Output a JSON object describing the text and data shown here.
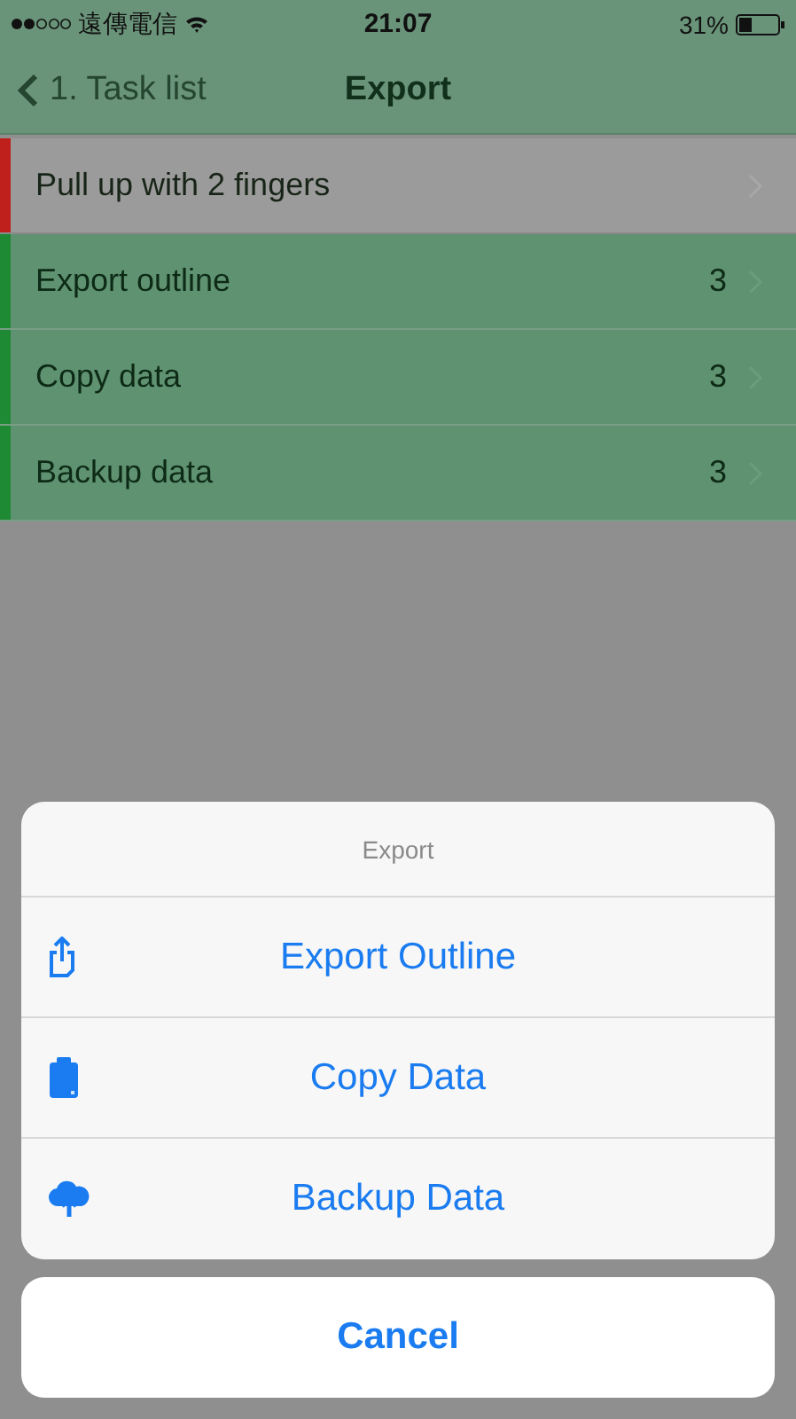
{
  "status_bar": {
    "carrier": "遠傳電信",
    "time": "21:07",
    "battery": "31%"
  },
  "nav": {
    "back": "1. Task list",
    "title": "Export"
  },
  "rows": [
    {
      "kind": "hint",
      "label": "Pull up with 2 fingers",
      "color": "#c0201c"
    },
    {
      "kind": "list",
      "label": "Export outline",
      "count": "3",
      "color": "#1f8a34"
    },
    {
      "kind": "list",
      "label": "Copy data",
      "count": "3",
      "color": "#1f8a34"
    },
    {
      "kind": "list",
      "label": "Backup data",
      "count": "3",
      "color": "#1f8a34"
    }
  ],
  "action_sheet": {
    "title": "Export",
    "actions": [
      {
        "kind": "export",
        "label": "Export Outline"
      },
      {
        "kind": "copy",
        "label": "Copy Data"
      },
      {
        "kind": "backup",
        "label": "Backup Data"
      }
    ],
    "cancel": "Cancel"
  }
}
